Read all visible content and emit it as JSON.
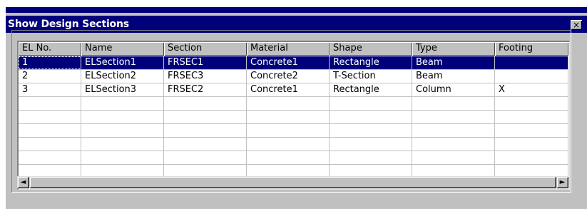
{
  "window": {
    "title": "Show Design Sections",
    "close_glyph": "×"
  },
  "table": {
    "columns": [
      "EL No.",
      "Name",
      "Section",
      "Material",
      "Shape",
      "Type",
      "Footing"
    ],
    "rows": [
      [
        "1",
        "ELSection1",
        "FRSEC1",
        "Concrete1",
        "Rectangle",
        "Beam",
        ""
      ],
      [
        "2",
        "ELSection2",
        "FRSEC3",
        "Concrete2",
        "T-Section",
        "Beam",
        ""
      ],
      [
        "3",
        "ELSection3",
        "FRSEC2",
        "Concrete1",
        "Rectangle",
        "Column",
        "X"
      ]
    ],
    "selected_row": "1",
    "empty_row_count": 6
  },
  "scrollbar": {
    "left_arrow": "◄",
    "right_arrow": "►"
  },
  "colors": {
    "title_bar": "#00007b",
    "selection": "#00007b",
    "face": "#c0c0c0"
  }
}
